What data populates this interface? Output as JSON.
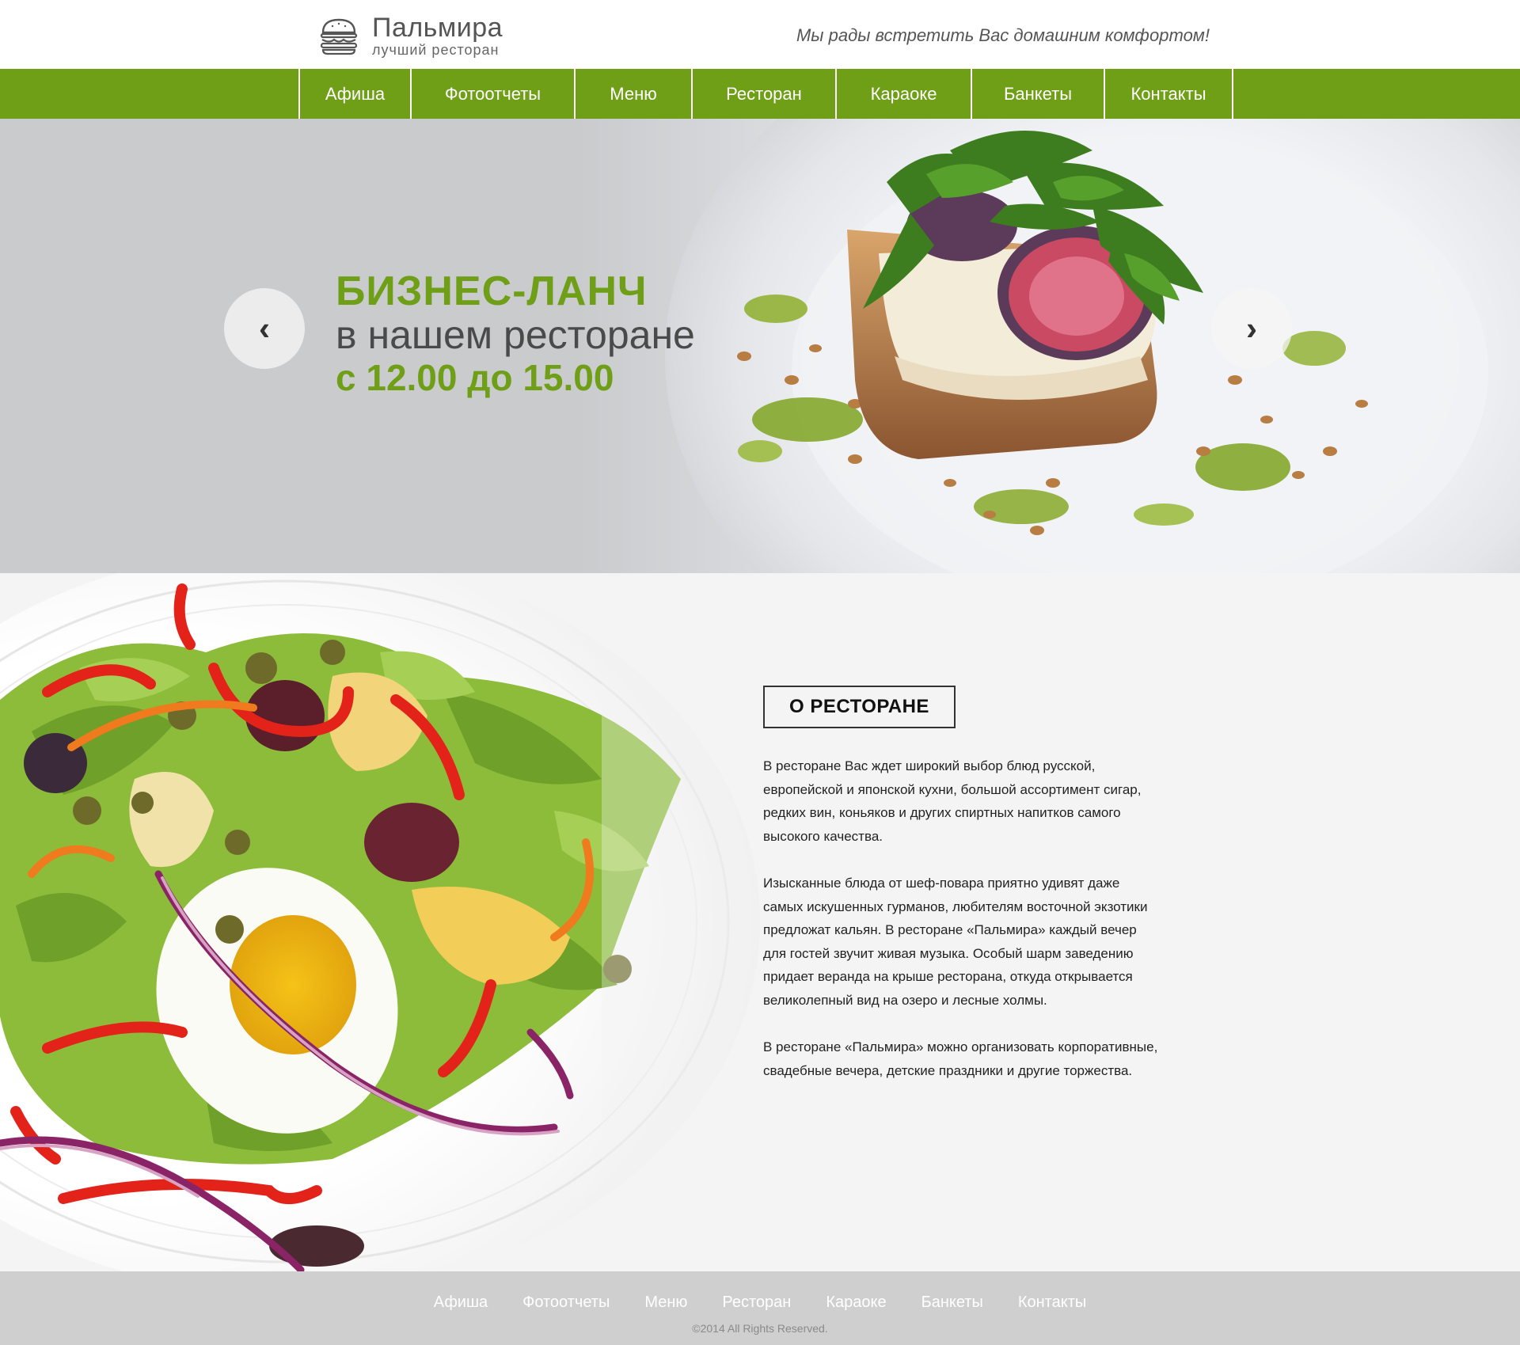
{
  "brand": {
    "title": "Пальмира",
    "subtitle": "лучший ресторан",
    "icon": "burger-icon"
  },
  "tagline": "Мы рады встретить Вас домашним комфортом!",
  "colors": {
    "accent": "#6f9e17",
    "nav_bg": "#6f9e17",
    "hero_bg": "#c9cbcd",
    "footer_bg": "#cfcfcf"
  },
  "nav": {
    "items": [
      {
        "label": "Афиша"
      },
      {
        "label": "Фотоотчеты"
      },
      {
        "label": "Меню"
      },
      {
        "label": "Ресторан"
      },
      {
        "label": "Караоке"
      },
      {
        "label": "Банкеты"
      },
      {
        "label": "Контакты"
      }
    ]
  },
  "hero": {
    "line1": "БИЗНЕС-ЛАНЧ",
    "line2": "в нашем ресторане",
    "line3": "с 12.00 до 15.00",
    "prev_icon": "chevron-left-icon",
    "next_icon": "chevron-right-icon",
    "prev_glyph": "‹",
    "next_glyph": "›"
  },
  "about": {
    "heading": "О РЕСТОРАНЕ",
    "paragraphs": [
      "В ресторане Вас ждет широкий выбор блюд русской, европейской и японской кухни, большой ассортимент сигар, редких вин, коньяков и других спиртных напитков самого высокого качества.",
      "Изысканные блюда от шеф-повара приятно удивят даже самых искушенных гурманов, любителям восточной экзотики предложат кальян. В ресторане «Пальмира» каждый вечер для гостей звучит живая музыка. Особый шарм заведению придает веранда на крыше ресторана, откуда открывается великолепный вид на озеро и лесные холмы.",
      "В ресторане «Пальмира» можно организовать корпоративные, свадебные вечера, детские праздники и другие торжества."
    ]
  },
  "footer": {
    "items": [
      {
        "label": "Афиша"
      },
      {
        "label": "Фотоотчеты"
      },
      {
        "label": "Меню"
      },
      {
        "label": "Ресторан"
      },
      {
        "label": "Караоке"
      },
      {
        "label": "Банкеты"
      },
      {
        "label": "Контакты"
      }
    ],
    "copyright": "©2014  All Rights Reserved."
  }
}
